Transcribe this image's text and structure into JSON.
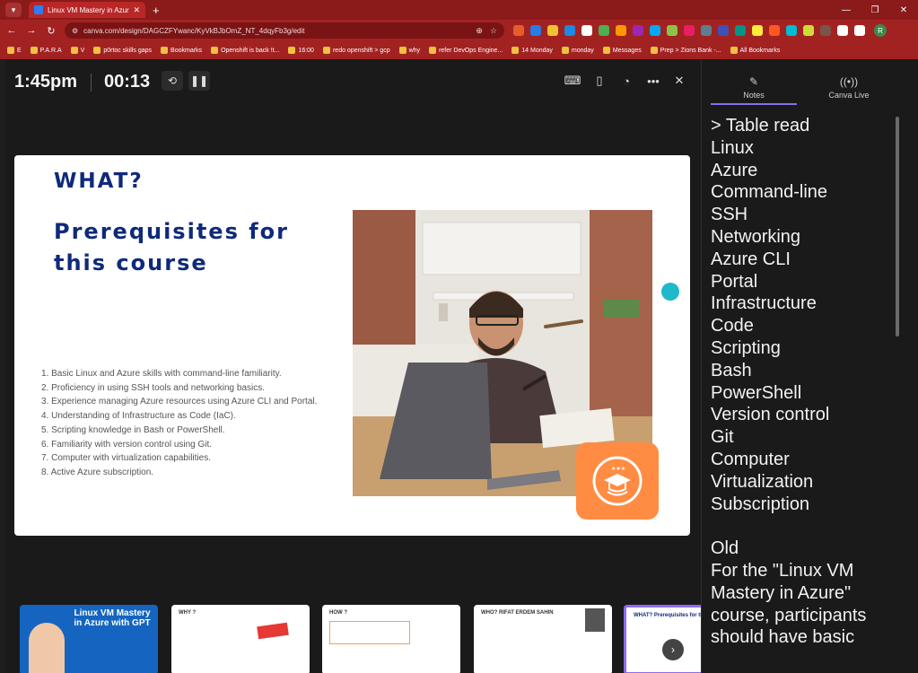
{
  "browser": {
    "tab_title": "Linux VM Mastery in Azure with",
    "url": "canva.com/design/DAGCZFYwanc/KyVkBJbOmZ_NT_4dqyFb3g/edit",
    "bookmarks": [
      "E",
      "P.A.R.A",
      "V",
      "p0rtoc skills gaps",
      "Bookmarks",
      "Openshift is back !t...",
      "16:00",
      "redo openshift > gcp",
      "why",
      "refer DevOps Engine...",
      "14 Monday",
      "monday",
      "Messages",
      "Prep > Zions Bank -...",
      "All Bookmarks"
    ],
    "avatar_letter": "R"
  },
  "presenter": {
    "clock": "1:45pm",
    "timer": "00:13"
  },
  "slide": {
    "heading": "WHAT?",
    "subheading": "Prerequisites for this course",
    "items": [
      "1. Basic Linux and Azure skills with command-line familiarity.",
      "2. Proficiency in using SSH tools and networking basics.",
      "3. Experience managing Azure resources using Azure CLI and Portal.",
      "4. Understanding of Infrastructure as Code (IaC).",
      "5. Scripting knowledge in Bash or PowerShell.",
      "6. Familiarity with version control using Git.",
      "7. Computer with virtualization capabilities.",
      "8. Active Azure subscription."
    ]
  },
  "thumbnails": [
    {
      "title": "Linux VM Mastery in Azure with GPT"
    },
    {
      "title": "WHY ?"
    },
    {
      "title": "HOW ?"
    },
    {
      "title": "WHO? RIFAT ERDEM SAHIN"
    },
    {
      "title": "WHAT? Prerequisites for the course"
    }
  ],
  "notes_panel": {
    "tab_notes": "Notes",
    "tab_live": "Canva Live",
    "text": "> Table read\nLinux\nAzure\nCommand-line\nSSH\nNetworking\nAzure CLI\nPortal\nInfrastructure\nCode\nScripting\nBash\nPowerShell\nVersion control\nGit\nComputer\nVirtualization\nSubscription\n\nOld\nFor the \"Linux VM Mastery in Azure\" course, participants should have basic"
  }
}
